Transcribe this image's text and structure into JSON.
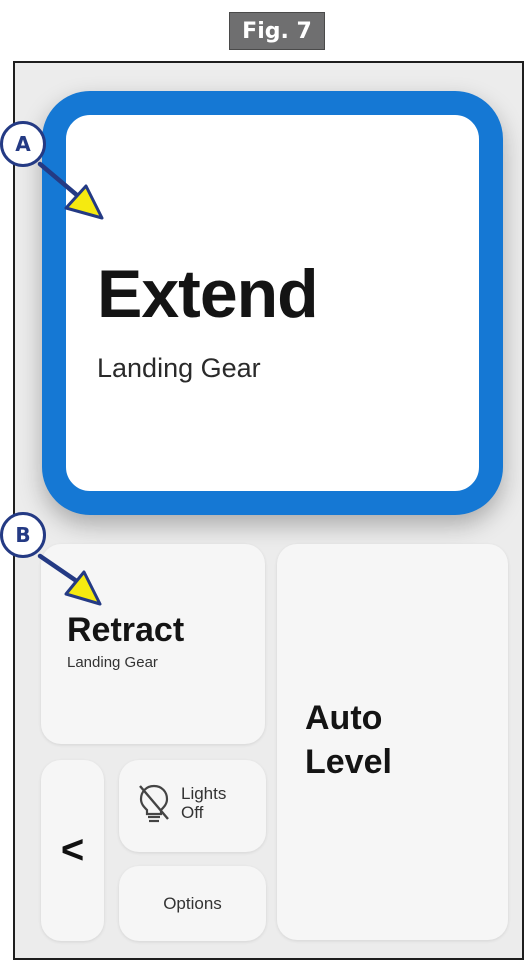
{
  "figure": {
    "label": "Fig. 7"
  },
  "callouts": {
    "a": "A",
    "b": "B"
  },
  "main_button": {
    "title": "Extend",
    "subtitle": "Landing Gear"
  },
  "retract_button": {
    "title": "Retract",
    "subtitle": "Landing Gear"
  },
  "auto_level_button": {
    "line1": "Auto",
    "line2": "Level"
  },
  "back_button": {
    "icon": "chevron-left-icon",
    "glyph": "<"
  },
  "lights_button": {
    "icon": "lightbulb-off-icon",
    "line1": "Lights",
    "line2": "Off"
  },
  "options_button": {
    "label": "Options"
  },
  "colors": {
    "accent_blue": "#1578d4",
    "callout_navy": "#243a84",
    "arrow_yellow": "#f5ea10",
    "figure_label_bg": "#6f6f70",
    "panel_bg": "#ececec",
    "tile_bg": "#f6f6f6"
  }
}
